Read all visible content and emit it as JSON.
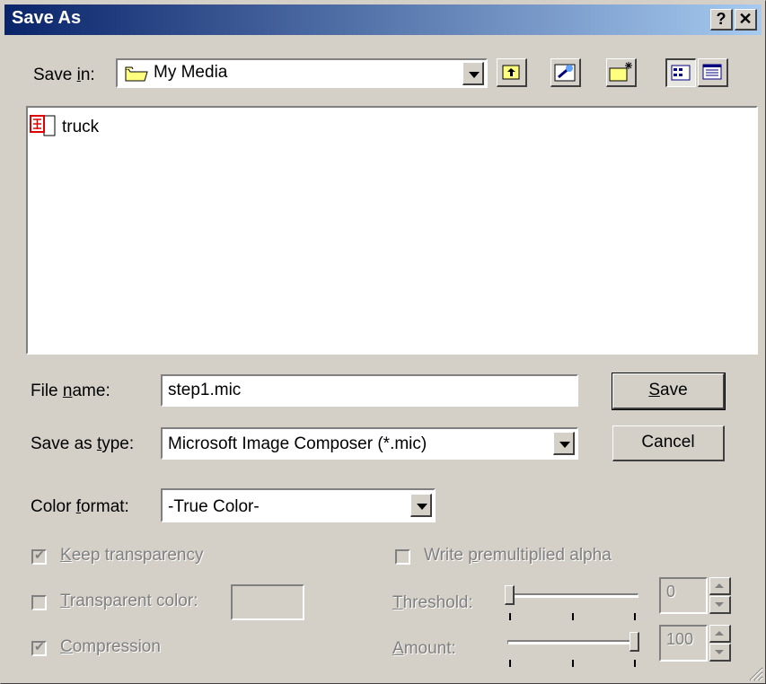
{
  "window": {
    "title": "Save As",
    "help_label": "?",
    "close_label": "✕"
  },
  "save_in": {
    "label_pre": "Save ",
    "label_u": "i",
    "label_post": "n:",
    "value": "My Media"
  },
  "files": [
    {
      "name": "truck",
      "icon": "image-file-icon"
    }
  ],
  "filename": {
    "label_pre": "File ",
    "label_u": "n",
    "label_post": "ame:",
    "value": "step1.mic"
  },
  "save_type": {
    "label_pre": "Save as ",
    "label_u": "t",
    "label_post": "ype:",
    "value": "Microsoft Image Composer (*.mic)"
  },
  "color_format": {
    "label_pre": "Color ",
    "label_u": "f",
    "label_post": "ormat:",
    "value": "-True Color-"
  },
  "buttons": {
    "save_u": "S",
    "save_rest": "ave",
    "cancel": "Cancel"
  },
  "options": {
    "keep_transparency": {
      "u": "K",
      "rest": "eep transparency",
      "checked": true
    },
    "transparent_color": {
      "u": "T",
      "rest": "ransparent color:",
      "checked": false
    },
    "compression": {
      "u": "C",
      "rest": "ompression",
      "checked": true
    },
    "premultiplied": {
      "pre": "Write ",
      "u": "p",
      "rest": "remultiplied alpha",
      "checked": false
    },
    "threshold": {
      "u": "T",
      "rest": "hreshold:",
      "value": "0",
      "level": 0
    },
    "amount": {
      "u": "A",
      "rest": "mount:",
      "value": "100",
      "level": 1
    }
  }
}
